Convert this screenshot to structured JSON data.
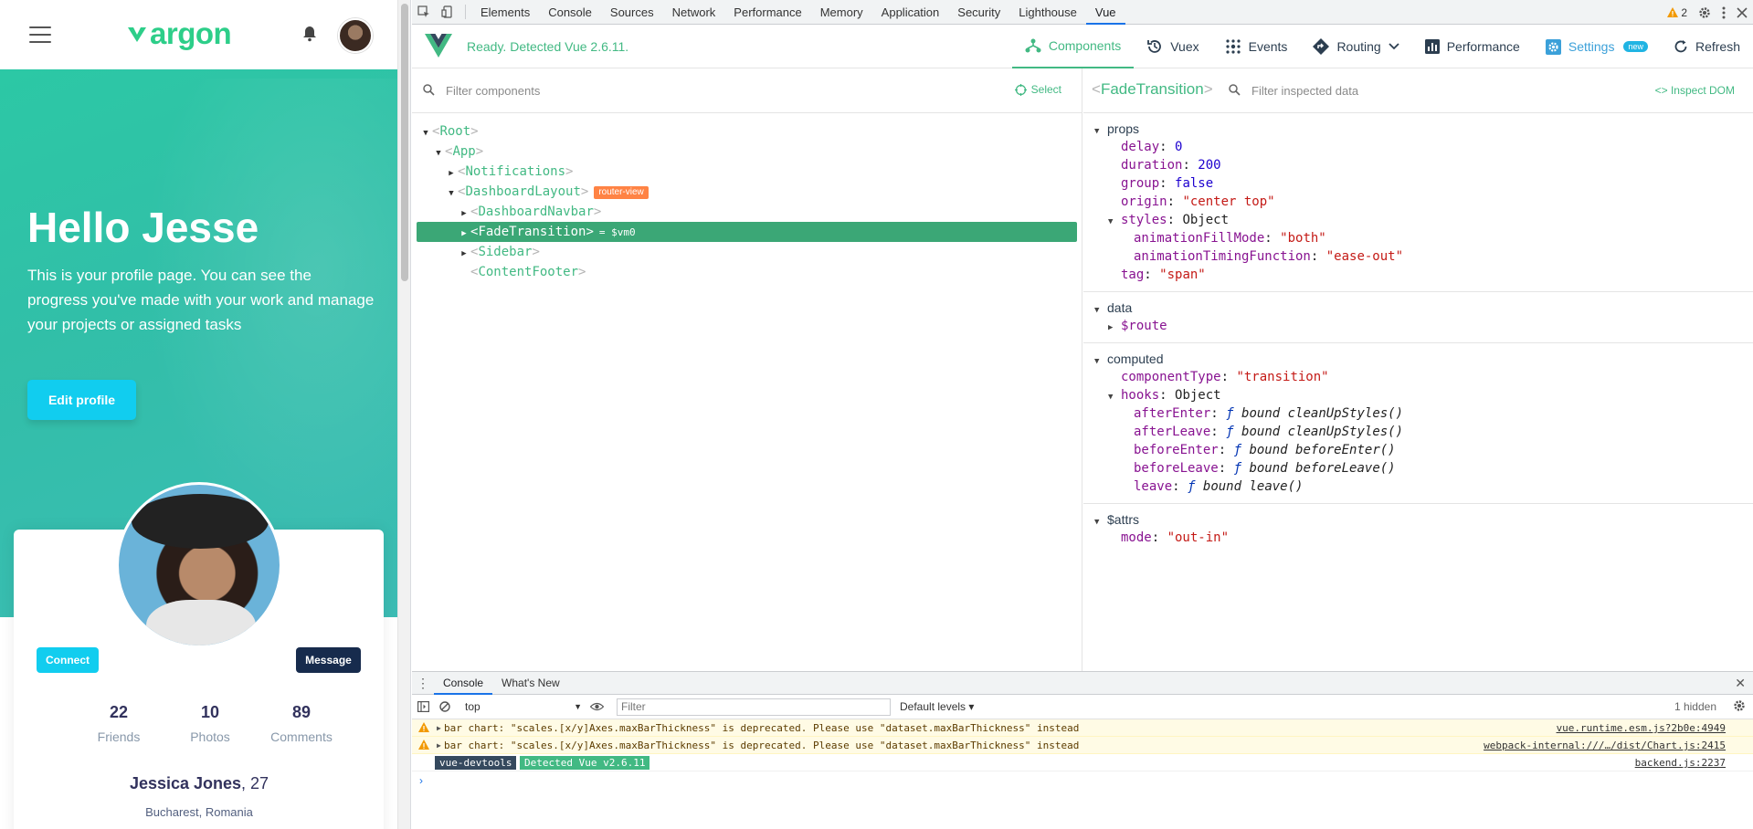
{
  "app": {
    "logo_text": "argon",
    "hero_title": "Hello Jesse",
    "hero_text": "This is your profile page. You can see the progress you've made with your work and manage your projects or assigned tasks",
    "edit_button": "Edit profile",
    "connect_button": "Connect",
    "message_button": "Message",
    "stats": [
      {
        "value": "22",
        "label": "Friends"
      },
      {
        "value": "10",
        "label": "Photos"
      },
      {
        "value": "89",
        "label": "Comments"
      }
    ],
    "person_name": "Jessica Jones",
    "person_age": ", 27",
    "location": "Bucharest, Romania",
    "brand_color": "#2dce89",
    "info_color": "#11cdef"
  },
  "devtools": {
    "tabs": [
      "Elements",
      "Console",
      "Sources",
      "Network",
      "Performance",
      "Memory",
      "Application",
      "Security",
      "Lighthouse",
      "Vue"
    ],
    "active_tab": "Vue",
    "warning_count": "2"
  },
  "vue": {
    "status": "Ready. Detected Vue 2.6.11.",
    "nav": {
      "components": "Components",
      "vuex": "Vuex",
      "events": "Events",
      "routing": "Routing",
      "performance": "Performance",
      "settings": "Settings",
      "settings_badge": "new",
      "refresh": "Refresh"
    },
    "filter_placeholder": "Filter components",
    "select_label": "Select",
    "tree": [
      {
        "name": "Root",
        "depth": 0,
        "arrow": "down"
      },
      {
        "name": "App",
        "depth": 1,
        "arrow": "down"
      },
      {
        "name": "Notifications",
        "depth": 2,
        "arrow": "right"
      },
      {
        "name": "DashboardLayout",
        "depth": 2,
        "arrow": "down",
        "badge": "router-view"
      },
      {
        "name": "DashboardNavbar",
        "depth": 3,
        "arrow": "right"
      },
      {
        "name": "FadeTransition",
        "depth": 3,
        "arrow": "right",
        "selected": true,
        "ref": "= $vm0"
      },
      {
        "name": "Sidebar",
        "depth": 3,
        "arrow": "right"
      },
      {
        "name": "ContentFooter",
        "depth": 3,
        "arrow": "none"
      }
    ],
    "inspector": {
      "component_name": "FadeTransition",
      "filter_placeholder": "Filter inspected data",
      "inspect_dom": "Inspect DOM",
      "sections": {
        "props": "props",
        "data": "data",
        "computed": "computed",
        "attrs": "$attrs"
      },
      "props": {
        "delay_k": "delay",
        "delay_v": "0",
        "duration_k": "duration",
        "duration_v": "200",
        "group_k": "group",
        "group_v": "false",
        "origin_k": "origin",
        "origin_v": "\"center top\"",
        "styles_k": "styles",
        "styles_v": "Object",
        "afm_k": "animationFillMode",
        "afm_v": "\"both\"",
        "atf_k": "animationTimingFunction",
        "atf_v": "\"ease-out\"",
        "tag_k": "tag",
        "tag_v": "\"span\""
      },
      "data_route": "$route",
      "computed": {
        "ct_k": "componentType",
        "ct_v": "\"transition\"",
        "hooks_k": "hooks",
        "hooks_v": "Object",
        "ae_k": "afterEnter",
        "ae_v": "bound cleanUpStyles()",
        "al_k": "afterLeave",
        "al_v": "bound cleanUpStyles()",
        "be_k": "beforeEnter",
        "be_v": "bound beforeEnter()",
        "bl_k": "beforeLeave",
        "bl_v": "bound beforeLeave()",
        "lv_k": "leave",
        "lv_v": "bound leave()",
        "fn_symbol": "ƒ"
      },
      "attrs": {
        "mode_k": "mode",
        "mode_v": "\"out-in\""
      }
    }
  },
  "console": {
    "tab_console": "Console",
    "tab_whats_new": "What's New",
    "context": "top",
    "filter_placeholder": "Filter",
    "levels": "Default levels",
    "hidden": "1 hidden",
    "messages": [
      {
        "text": "bar chart: \"scales.[x/y]Axes.maxBarThickness\" is deprecated. Please use \"dataset.maxBarThickness\" instead",
        "source": "vue.runtime.esm.js?2b0e:4949"
      },
      {
        "text": "bar chart: \"scales.[x/y]Axes.maxBarThickness\" is deprecated. Please use \"dataset.maxBarThickness\" instead",
        "source": "webpack-internal:///…/dist/Chart.js:2415"
      }
    ],
    "devtools_tag": "vue-devtools",
    "detected_tag": "Detected Vue v2.6.11",
    "backend_source": "backend.js:2237",
    "prompt": "›"
  }
}
